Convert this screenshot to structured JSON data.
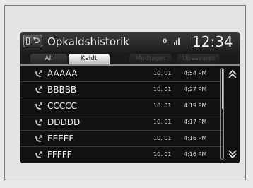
{
  "header": {
    "title": "Opkaldshistorik",
    "status_label": "0",
    "clock": "12:34",
    "icons": [
      "phone-icon",
      "back-icon",
      "signal-icon"
    ]
  },
  "tabs": [
    {
      "label": "All",
      "state": "normal"
    },
    {
      "label": "Kaldt",
      "state": "active"
    },
    {
      "label": "Modtaget",
      "state": "disabled"
    },
    {
      "label": "Ubesvaret",
      "state": "disabled"
    }
  ],
  "calls": [
    {
      "name": "AAAAA",
      "date": "10. 01",
      "time": "4:54 PM"
    },
    {
      "name": "BBBBB",
      "date": "10. 01",
      "time": "4:27 PM"
    },
    {
      "name": "CCCCC",
      "date": "10. 01",
      "time": "4:19 PM"
    },
    {
      "name": "DDDDD",
      "date": "10. 01",
      "time": "4:17 PM"
    },
    {
      "name": "EEEEE",
      "date": "10. 01",
      "time": "4:16 PM"
    },
    {
      "name": "FFFFF",
      "date": "10. 01",
      "time": "4:16 PM"
    }
  ],
  "colors": {
    "screen_bg": "#111111",
    "text": "#f0f0f0",
    "active_tab": "#ffffff"
  }
}
